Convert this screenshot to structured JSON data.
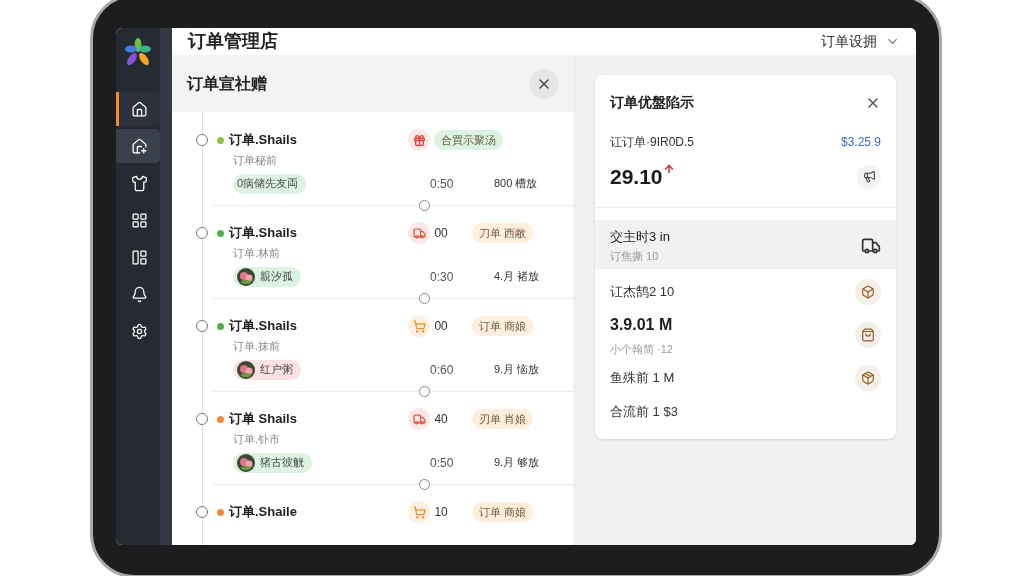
{
  "app": {
    "title": "订单管理店",
    "menu": "订单设拥"
  },
  "sidebar": {
    "items": [
      {
        "kind": "home",
        "selected": true,
        "highlighted": false
      },
      {
        "kind": "upload",
        "selected": false,
        "highlighted": true
      },
      {
        "kind": "shirt",
        "selected": false,
        "highlighted": false
      },
      {
        "kind": "grid",
        "selected": false,
        "highlighted": false
      },
      {
        "kind": "layout",
        "selected": false,
        "highlighted": false
      },
      {
        "kind": "bell",
        "selected": false,
        "highlighted": false
      },
      {
        "kind": "gear",
        "selected": false,
        "highlighted": false
      }
    ]
  },
  "orders_panel": {
    "title": "订单宣社赠",
    "orders": [
      {
        "kind": "gift",
        "title": "订单.Shails",
        "subtitle": "订单秘前",
        "color": "#8bc34a",
        "tag": {
          "text": "0病储先友両",
          "color": "#dcf3e3",
          "picture": false
        },
        "time": "0:50",
        "amount": "800 槽放",
        "badge": {
          "text": "合買示聚汤",
          "color": "#dcf3e3"
        }
      },
      {
        "kind": "truck",
        "title": "订单.Shails",
        "subtitle": "订单.林前",
        "color": "#4caf50",
        "tag": {
          "text": "親汐孤",
          "color": "#dcf3e3",
          "picture": true
        },
        "time": "0:30",
        "amount": "4.月 褚放",
        "count": "00",
        "badge": {
          "text": "刀单 西敝",
          "color": "#fdeedd"
        }
      },
      {
        "kind": "cart",
        "title": "订单.Shails",
        "subtitle": "订单.抹前",
        "color": "#4caf50",
        "tag": {
          "text": "红户粥",
          "color": "#fbe0e4",
          "picture": true
        },
        "time": "0:60",
        "amount": "9.月 恼放",
        "count": "00",
        "badge": {
          "text": "订单 商娘",
          "color": "#fdeedd"
        }
      },
      {
        "kind": "truck",
        "title": "订单 Shails",
        "subtitle": "订单.钋市",
        "color": "#f5883a",
        "tag": {
          "text": "猪古彼觥",
          "color": "#dcf3e3",
          "picture": true
        },
        "time": "0:50",
        "amount": "9.月 够放",
        "count": "40",
        "badge": {
          "text": "刃单 肖娘",
          "color": "#fdeedd"
        }
      },
      {
        "kind": "cart",
        "title": "订单.Shaile",
        "color": "#f5883a",
        "count": "10",
        "badge": {
          "text": "订单 商娘",
          "color": "#fdeedd"
        }
      }
    ]
  },
  "detail_card": {
    "title": "订单优盤陷示",
    "order_line": "讧订单·9IR0D.5",
    "price": "$3.25 9",
    "value": "29.10",
    "trend_up": true,
    "shipping": {
      "title": "交主时3 in",
      "subtitle": "订焦撕 10"
    },
    "stats": [
      {
        "kind": "box",
        "label": "讧杰鹄2 10"
      },
      {
        "kind": "bag",
        "label": "3.9.01 M",
        "note": "小个翰简 ·12"
      },
      {
        "kind": "parcel",
        "label": "鱼殊前 1 M"
      },
      {
        "kind": "plain",
        "label": "合流前 1 $3"
      }
    ]
  }
}
